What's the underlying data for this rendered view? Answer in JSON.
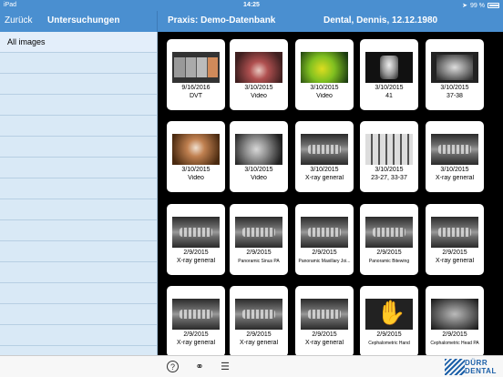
{
  "status_bar": {
    "carrier": "iPad",
    "time": "14:25",
    "battery": "99 %"
  },
  "nav": {
    "back_label": "Zurück",
    "left_title": "Untersuchungen",
    "practice": "Praxis: Demo-Datenbank",
    "patient": "Dental, Dennis, 12.12.1980"
  },
  "sidebar": {
    "items": [
      "All images"
    ]
  },
  "cards": [
    {
      "date": "9/16/2016",
      "type": "DVT",
      "thumb": "dvt"
    },
    {
      "date": "3/10/2015",
      "type": "Video",
      "thumb": "vid1"
    },
    {
      "date": "3/10/2015",
      "type": "Video",
      "thumb": "vid2"
    },
    {
      "date": "3/10/2015",
      "type": "41",
      "thumb": "xr41"
    },
    {
      "date": "3/10/2015",
      "type": "37-38",
      "thumb": "xr37"
    },
    {
      "date": "3/10/2015",
      "type": "Video",
      "thumb": "vid3"
    },
    {
      "date": "3/10/2015",
      "type": "Video",
      "thumb": "vid4"
    },
    {
      "date": "3/10/2015",
      "type": "X-ray general",
      "thumb": "pan"
    },
    {
      "date": "3/10/2015",
      "type": "23-27, 33-37",
      "thumb": "bite"
    },
    {
      "date": "3/10/2015",
      "type": "X-ray general",
      "thumb": "pan"
    },
    {
      "date": "2/9/2015",
      "type": "X-ray general",
      "thumb": "pan"
    },
    {
      "date": "2/9/2015",
      "type": "Panoramic Sinus PA",
      "thumb": "pan"
    },
    {
      "date": "2/9/2015",
      "type": "Panoramic Maxillary Joi...",
      "thumb": "pan"
    },
    {
      "date": "2/9/2015",
      "type": "Panoramic Bitewing",
      "thumb": "pan"
    },
    {
      "date": "2/9/2015",
      "type": "X-ray general",
      "thumb": "pan"
    },
    {
      "date": "2/9/2015",
      "type": "X-ray general",
      "thumb": "pan"
    },
    {
      "date": "2/9/2015",
      "type": "X-ray general",
      "thumb": "pan"
    },
    {
      "date": "2/9/2015",
      "type": "X-ray general",
      "thumb": "pan"
    },
    {
      "date": "2/9/2015",
      "type": "Cephalometric Hand",
      "thumb": "ceph"
    },
    {
      "date": "2/9/2015",
      "type": "Cephalometric Head PA",
      "thumb": "cephhead"
    }
  ],
  "toolbar": {
    "help_icon": "question-circle-icon",
    "link_icon": "link-icon",
    "doc_icon": "document-icon",
    "logo_line1": "DÜRR",
    "logo_line2": "DENTAL"
  },
  "colors": {
    "nav_blue": "#4a8fd0",
    "sidebar_bg": "#d9e9f6",
    "logo_blue": "#1b5fa8"
  }
}
